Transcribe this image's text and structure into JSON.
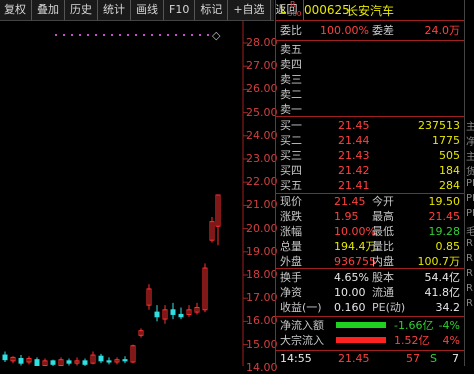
{
  "toolbar": {
    "items": [
      "复权",
      "叠加",
      "历史",
      "统计",
      "画线",
      "F10",
      "标记",
      "+自选",
      "返回"
    ]
  },
  "chart": {
    "price_labels": [
      "28.00",
      "27.00",
      "26.00",
      "25.00",
      "24.00",
      "23.00",
      "22.00",
      "21.00",
      "20.00",
      "19.00",
      "18.00",
      "17.00",
      "16.00",
      "15.00",
      "14.00"
    ],
    "diamond": "◇",
    "colors": {
      "up": "#ff3030",
      "down": "#30e0e0",
      "grid": "#a02020",
      "dotline": "#c050c0"
    }
  },
  "stock": {
    "prefix_l": "L",
    "prefix_r": "R",
    "prefix_sub": "300",
    "code": "000625",
    "name": "长安汽车"
  },
  "weibi": {
    "label1": "委比",
    "value1": "100.00%",
    "label2": "委差",
    "value2": "24.0万"
  },
  "sell": [
    {
      "label": "卖五",
      "price": "",
      "vol": ""
    },
    {
      "label": "卖四",
      "price": "",
      "vol": ""
    },
    {
      "label": "卖三",
      "price": "",
      "vol": ""
    },
    {
      "label": "卖二",
      "price": "",
      "vol": ""
    },
    {
      "label": "卖一",
      "price": "",
      "vol": ""
    }
  ],
  "buy": [
    {
      "label": "买一",
      "price": "21.45",
      "vol": "237513"
    },
    {
      "label": "买二",
      "price": "21.44",
      "vol": "1775"
    },
    {
      "label": "买三",
      "price": "21.43",
      "vol": "505"
    },
    {
      "label": "买四",
      "price": "21.42",
      "vol": "184"
    },
    {
      "label": "买五",
      "price": "21.41",
      "vol": "284"
    }
  ],
  "quote": [
    {
      "l1": "现价",
      "v1": "21.45",
      "l2": "今开",
      "v2": "19.50"
    },
    {
      "l1": "涨跌",
      "v1": "1.95",
      "l2": "最高",
      "v2": "21.45"
    },
    {
      "l1": "涨幅",
      "v1": "10.00%",
      "l2": "最低",
      "v2": "19.28"
    },
    {
      "l1": "总量",
      "v1": "194.4万",
      "l2": "量比",
      "v2": "0.85"
    },
    {
      "l1": "外盘",
      "v1": "936755",
      "l2": "内盘",
      "v2": "100.7万"
    }
  ],
  "fund": [
    {
      "l1": "换手",
      "v1": "4.65%",
      "l2": "股本",
      "v2": "54.4亿"
    },
    {
      "l1": "净资",
      "v1": "10.00",
      "l2": "流通",
      "v2": "41.8亿"
    },
    {
      "l1": "收益(一)",
      "v1": "0.160",
      "l2": "PE(动)",
      "v2": "34.2"
    }
  ],
  "flow": [
    {
      "label": "净流入额",
      "value": "-1.66亿",
      "pct": "-4%"
    },
    {
      "label": "大宗流入",
      "value": "1.52亿",
      "pct": "4%"
    }
  ],
  "tick": {
    "time": "14:55",
    "price": "21.45",
    "vol": "57",
    "flag": "S",
    "count": "7"
  },
  "edge_labels": [
    "主",
    "净",
    "主",
    "货",
    "PI",
    "PI",
    "PI",
    "毛",
    "R",
    "R",
    "R",
    "R",
    "R"
  ]
}
